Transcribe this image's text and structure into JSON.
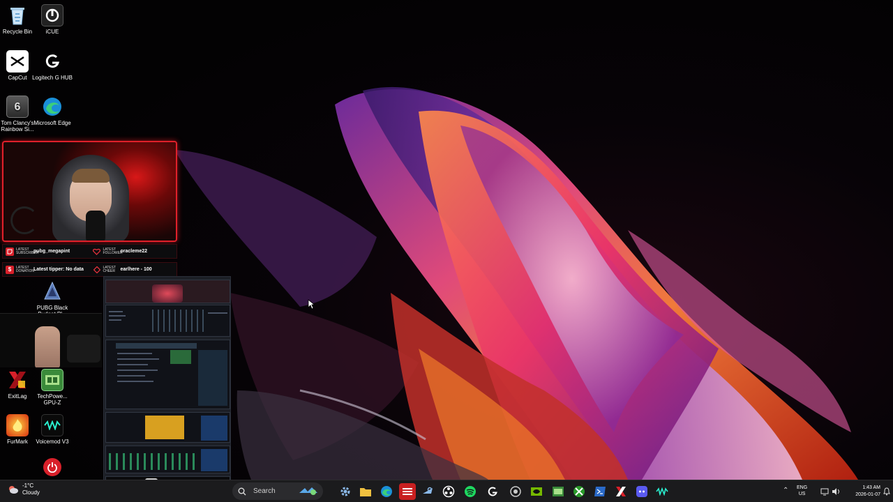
{
  "desktop_icons": [
    {
      "name": "recycle-bin",
      "label": "Recycle Bin",
      "icon": "recycle-bin-icon"
    },
    {
      "name": "icue",
      "label": "iCUE",
      "icon": "icue-icon"
    },
    {
      "name": "capcut",
      "label": "CapCut",
      "icon": "capcut-icon"
    },
    {
      "name": "logitech-g-hub",
      "label": "Logitech G HUB",
      "icon": "logitech-icon"
    },
    {
      "name": "rainbow-six",
      "label": "Tom Clancy's Rainbow Si...",
      "icon": "rainbow-six-icon"
    },
    {
      "name": "microsoft-edge",
      "label": "Microsoft Edge",
      "icon": "edge-icon"
    },
    {
      "name": "pubg",
      "label": "PUBG Black Budget Pl...",
      "icon": "pubg-icon"
    },
    {
      "name": "exitlag",
      "label": "ExitLag",
      "icon": "exitlag-icon"
    },
    {
      "name": "gpu-z",
      "label": "TechPowe... GPU-Z",
      "icon": "gpu-z-icon"
    },
    {
      "name": "furmark",
      "label": "FurMark",
      "icon": "furmark-icon"
    },
    {
      "name": "voicemod",
      "label": "Voicemod V3",
      "icon": "voicemod-icon"
    },
    {
      "name": "power",
      "label": "",
      "icon": "power-icon"
    }
  ],
  "alerts": {
    "subscriber": {
      "kind": "Latest Subscriber",
      "value": "pubg_megapint",
      "icon": "twitch-icon"
    },
    "follower": {
      "kind": "Latest Follower",
      "value": "oracleme22",
      "icon": "heart-icon"
    },
    "donation": {
      "kind": "Latest Donation",
      "value": "Latest tipper: No data",
      "icon": "dollar-icon",
      "icon_text": "$"
    },
    "cheer": {
      "kind": "Latest Cheer",
      "value": "earlhere - 100",
      "icon": "diamond-icon"
    }
  },
  "taskbar": {
    "weather": {
      "temp": "-1°C",
      "condition": "Cloudy"
    },
    "search_placeholder": "Search",
    "apps": [
      {
        "name": "settings",
        "icon": "gear-icon"
      },
      {
        "name": "file-explorer",
        "icon": "folder-icon"
      },
      {
        "name": "edge",
        "icon": "edge-icon"
      },
      {
        "name": "streaming-app",
        "icon": "stream-icon"
      },
      {
        "name": "steam",
        "icon": "steam-icon"
      },
      {
        "name": "obs",
        "icon": "obs-icon"
      },
      {
        "name": "spotify",
        "icon": "spotify-icon"
      },
      {
        "name": "logitech",
        "icon": "logitech-icon"
      },
      {
        "name": "app-circle",
        "icon": "circle-app-icon"
      },
      {
        "name": "nvidia",
        "icon": "nvidia-icon"
      },
      {
        "name": "gpu-z",
        "icon": "gpu-z-icon"
      },
      {
        "name": "xbox",
        "icon": "xbox-icon"
      },
      {
        "name": "powershell",
        "icon": "terminal-icon"
      },
      {
        "name": "exitlag",
        "icon": "exitlag-icon"
      },
      {
        "name": "discord",
        "icon": "discord-icon"
      },
      {
        "name": "voicemod",
        "icon": "voicemod-icon"
      }
    ],
    "tray": {
      "lang_top": "ENG",
      "lang_bottom": "US",
      "time": "1:43 AM",
      "date": "2026-01-07"
    }
  }
}
